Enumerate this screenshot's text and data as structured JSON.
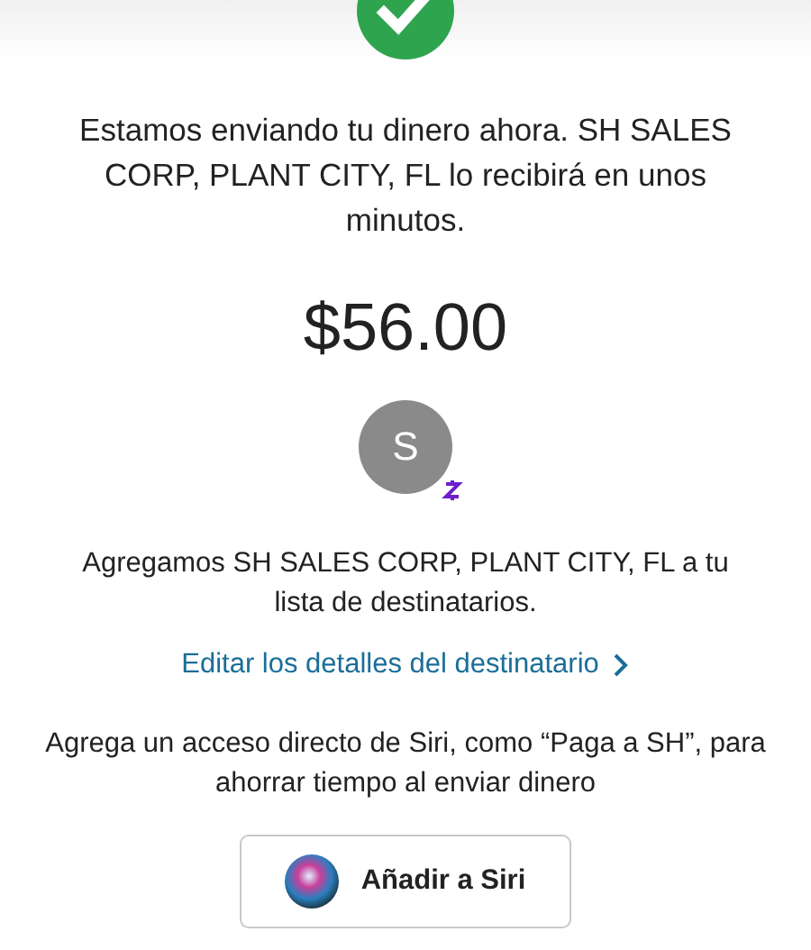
{
  "message": "Estamos enviando tu dinero ahora. SH SALES CORP, PLANT CITY, FL lo recibirá en unos minutos.",
  "amount": "$56.00",
  "recipient": {
    "initial": "S"
  },
  "added_message": "Agregamos SH SALES CORP, PLANT CITY, FL a tu lista de destinatarios.",
  "edit_link": "Editar los detalles del destinatario",
  "siri_message": "Agrega un acceso directo de Siri, como “Paga a SH”, para ahorrar tiempo al enviar dinero",
  "siri_button": "Añadir a Siri"
}
